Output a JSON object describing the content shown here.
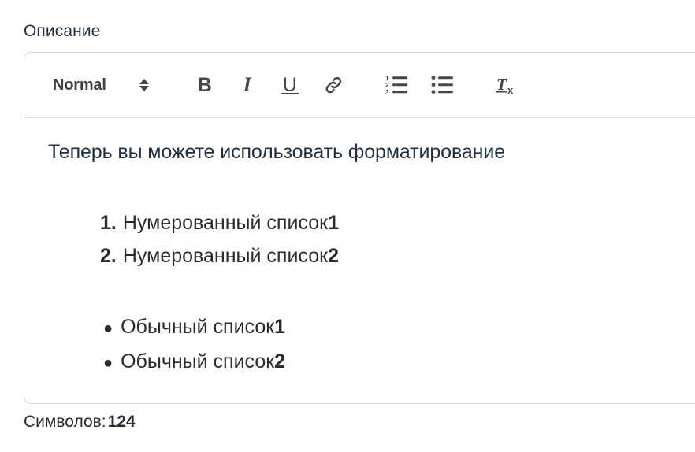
{
  "field": {
    "label": "Описание"
  },
  "editor": {
    "toolbar": {
      "format_picker": {
        "value": "Normal",
        "stepper_icon": "stepper-up-down-icon"
      },
      "buttons": [
        {
          "name": "bold",
          "label": "B",
          "icon": "bold-icon"
        },
        {
          "name": "italic",
          "label": "I",
          "icon": "italic-icon"
        },
        {
          "name": "underline",
          "label": "U",
          "icon": "underline-icon"
        },
        {
          "name": "link",
          "label": "",
          "icon": "link-icon"
        },
        {
          "name": "ordered-list",
          "label": "",
          "icon": "ordered-list-icon"
        },
        {
          "name": "bullet-list",
          "label": "",
          "icon": "bullet-list-icon"
        },
        {
          "name": "clear-format",
          "label": "",
          "icon": "clear-formatting-icon"
        }
      ]
    },
    "content": {
      "paragraph": "Теперь вы можете использовать форматирование",
      "ordered_list": [
        {
          "marker": "1.",
          "text": "Нумерованный список",
          "number": "1"
        },
        {
          "marker": "2.",
          "text": "Нумерованный список",
          "number": "2"
        }
      ],
      "bulleted_list": [
        {
          "marker": "●",
          "text": "Обычный список",
          "number": "1"
        },
        {
          "marker": "●",
          "text": "Обычный список",
          "number": "2"
        }
      ]
    }
  },
  "footer": {
    "counter_label": "Символов:",
    "counter_value": "124"
  },
  "colors": {
    "label_text": "#1f2d3d",
    "body_text": "#21303f",
    "list_text": "#2b2b2b",
    "toolbar_icon": "#444648",
    "border": "#d7dadd",
    "divider": "#dcdee0",
    "background": "#ffffff"
  }
}
